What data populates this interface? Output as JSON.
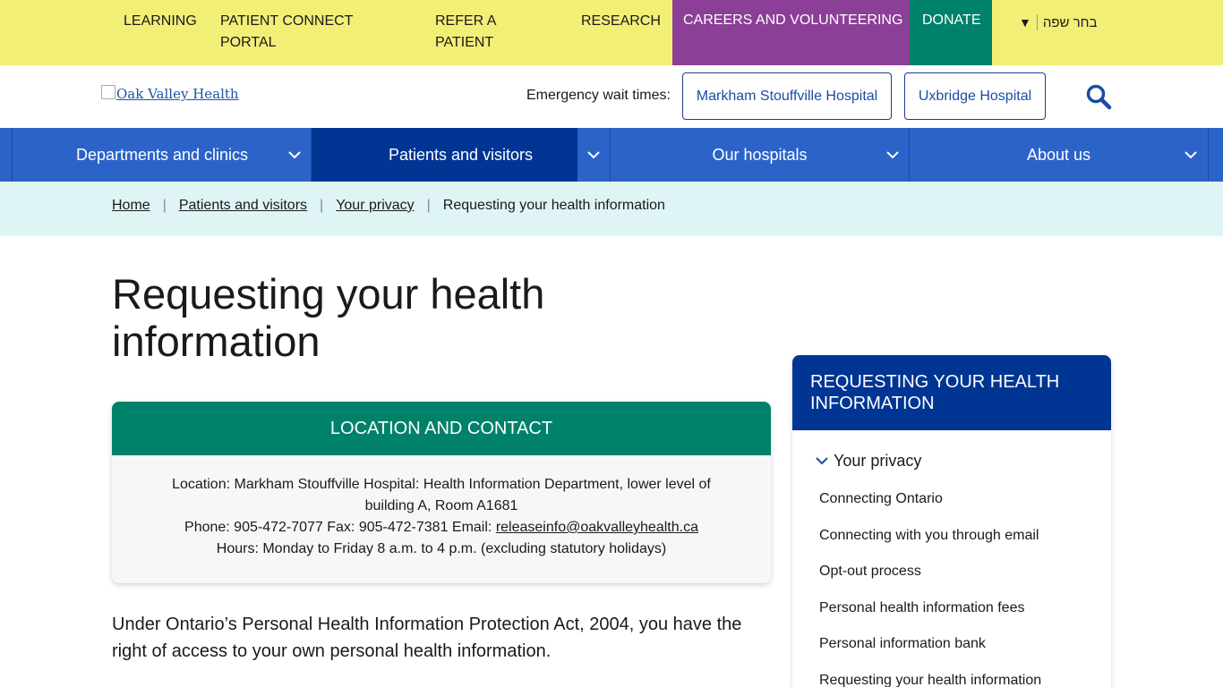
{
  "utility_nav": {
    "learning": "LEARNING",
    "patient_connect": "PATIENT CONNECT PORTAL",
    "refer": "REFER A PATIENT",
    "research": "RESEARCH",
    "careers": "CAREERS AND VOLUNTEERING",
    "donate": "DONATE",
    "language": "בחר שפה"
  },
  "header": {
    "logo_alt": "Oak Valley Health",
    "ewt_label": "Emergency wait times:",
    "markham_button": "Markham Stouffville Hospital",
    "uxbridge_button": "Uxbridge Hospital"
  },
  "main_nav": {
    "items": [
      {
        "label": "Departments and clinics"
      },
      {
        "label": "Patients and visitors"
      },
      {
        "label": "Our hospitals"
      },
      {
        "label": "About us"
      }
    ]
  },
  "breadcrumb": {
    "home": "Home",
    "patients": "Patients and visitors",
    "privacy": "Your privacy",
    "current": "Requesting your health information"
  },
  "page": {
    "title": "Requesting your health information",
    "intro": "Under Ontario’s Personal Health Information Protection Act, 2004, you have the right of access to your own personal health information."
  },
  "contact_card": {
    "heading": "LOCATION AND CONTACT",
    "location": "Location: Markham Stouffville Hospital: Health Information Department, lower level of building A, Room A1681",
    "phone_fax_prefix": "Phone: 905-472-7077 Fax: 905-472-7381 Email: ",
    "email": "releaseinfo@oakvalleyhealth.ca",
    "hours": "Hours: Monday to Friday 8 a.m. to 4 p.m. (excluding statutory holidays)"
  },
  "sidebar": {
    "heading": "Requesting your health information",
    "parent": "Your privacy",
    "links": [
      {
        "label": "Connecting Ontario"
      },
      {
        "label": "Connecting with you through email"
      },
      {
        "label": "Opt-out process"
      },
      {
        "label": "Personal health information fees"
      },
      {
        "label": "Personal information bank"
      },
      {
        "label": "Requesting your health information"
      }
    ]
  },
  "colors": {
    "utility_bg": "#f2ef77",
    "careers_bg": "#8b3f96",
    "donate_bg": "#00816a",
    "nav_bg": "#2c63c9",
    "nav_active": "#003594",
    "breadcrumb_bg": "#dff4f4"
  }
}
